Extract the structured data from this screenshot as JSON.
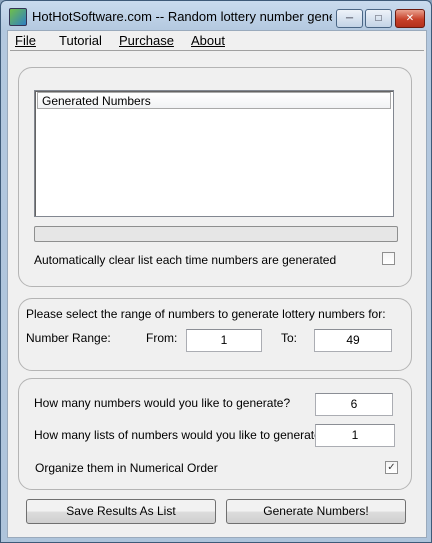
{
  "window": {
    "title": "HotHotSoftware.com -- Random lottery number gener...",
    "icons": {
      "app": "app-icon",
      "minimize": "minimize-icon",
      "maximize": "maximize-icon",
      "close": "close-icon"
    }
  },
  "menu": {
    "file": "File",
    "tutorial": "Tutorial",
    "purchase": "Purchase",
    "about": "About"
  },
  "results": {
    "column_header": "Generated Numbers",
    "rows": [],
    "progress": 0,
    "auto_clear_label": "Automatically clear list each time numbers are generated",
    "auto_clear_checked": false
  },
  "range": {
    "instruction": "Please select the range of numbers to generate lottery numbers for:",
    "range_label": "Number Range:",
    "from_label": "From:",
    "from_value": "1",
    "to_label": "To:",
    "to_value": "49"
  },
  "options": {
    "count_label": "How many numbers would you like to generate?",
    "count_value": "6",
    "lists_label": "How many lists of numbers would you like to generate?",
    "lists_value": "1",
    "order_label": "Organize them in Numerical Order",
    "order_checked": true
  },
  "buttons": {
    "save": "Save Results As List",
    "generate": "Generate Numbers!"
  }
}
